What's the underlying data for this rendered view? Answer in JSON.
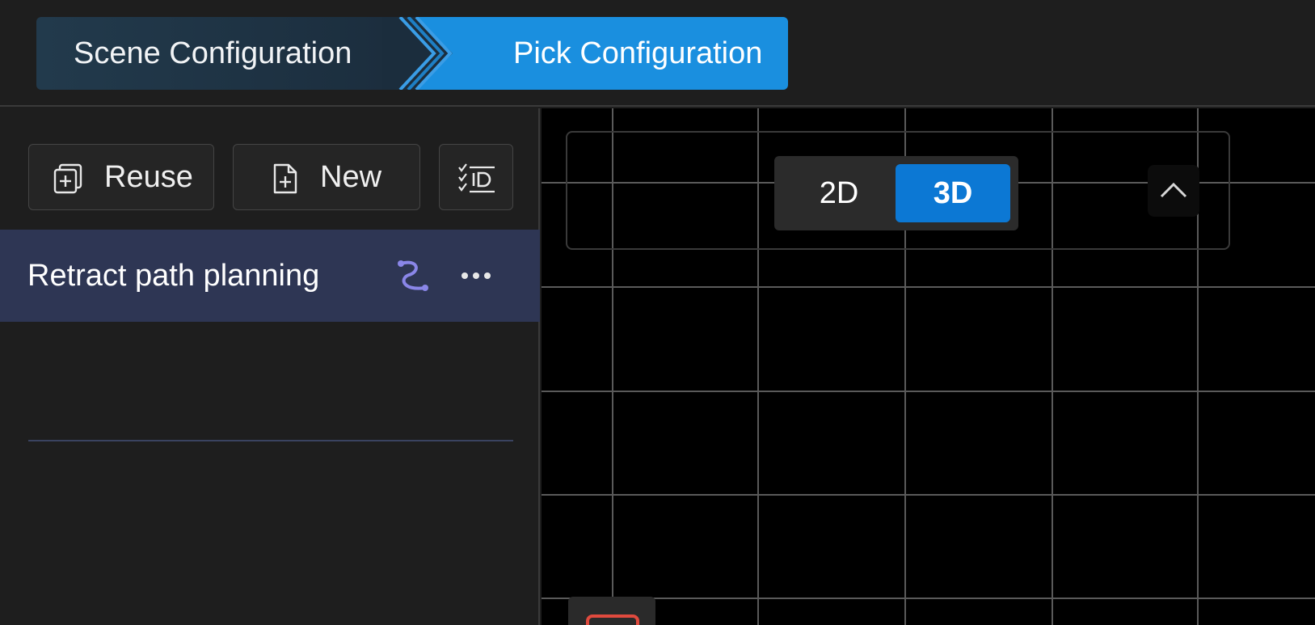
{
  "breadcrumb": {
    "steps": [
      {
        "label": "Scene Configuration"
      },
      {
        "label": "Pick Configuration"
      }
    ],
    "active_index": 1
  },
  "toolbar": {
    "reuse_label": "Reuse",
    "new_label": "New",
    "id_icon": "checklist-id-icon"
  },
  "list": {
    "items": [
      {
        "label": "Retract path planning",
        "icon": "path-curve-icon",
        "selected": true
      }
    ]
  },
  "viewport": {
    "view_mode": {
      "options": [
        "2D",
        "3D"
      ],
      "selected": "3D"
    }
  },
  "colors": {
    "accent": "#1a8fdf",
    "toggle_active": "#0c78d4",
    "selected_item_bg": "#2e3654",
    "path_icon": "#8a86e8",
    "corner_marker": "#e04a3e"
  }
}
